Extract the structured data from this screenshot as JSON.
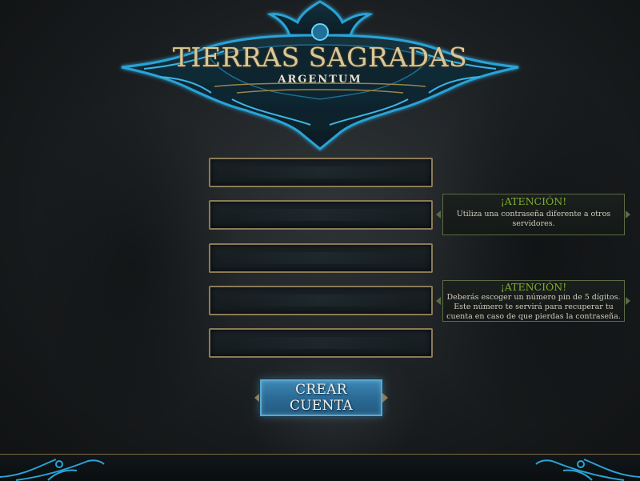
{
  "logo": {
    "title": "TIERRAS SAGRADAS",
    "subtitle": "ARGENTUM"
  },
  "form": {
    "fields": [
      {
        "value": "",
        "placeholder": ""
      },
      {
        "value": "",
        "placeholder": ""
      },
      {
        "value": "",
        "placeholder": ""
      },
      {
        "value": "",
        "placeholder": ""
      },
      {
        "value": "",
        "placeholder": ""
      }
    ],
    "submit_label": "CREAR CUENTA"
  },
  "notes": [
    {
      "title": "¡ATENCIÓN!",
      "body": "Utiliza una contraseña diferente a otros servidores."
    },
    {
      "title": "¡ATENCIÓN!",
      "body": "Deberás escoger un número pin de 5 dígitos. Este número te servirá para recuperar tu cuenta en caso de que pierdas la contraseña."
    }
  ],
  "colors": {
    "accent_blue": "#2f7aa8",
    "frame_gold": "#8a7b58",
    "attention_green": "#7fae2e",
    "ornament_blue": "#1f8fc0"
  }
}
